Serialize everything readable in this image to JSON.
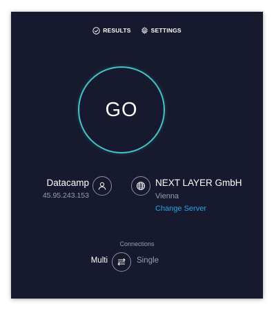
{
  "nav": {
    "results_label": "RESULTS",
    "settings_label": "SETTINGS"
  },
  "go_button": {
    "label": "GO"
  },
  "provider": {
    "name": "Datacamp",
    "ip": "45.95.243.153"
  },
  "server": {
    "name": "NEXT LAYER GmbH",
    "city": "Vienna",
    "change_label": "Change Server"
  },
  "connections": {
    "label": "Connections",
    "multi_label": "Multi",
    "single_label": "Single",
    "selected": "Multi"
  },
  "colors": {
    "background": "#171a2e",
    "accent_ring": "#3fc6c6",
    "link": "#1fa4e6",
    "muted_text": "#9a9eb0"
  },
  "icons": {
    "results": "check-circle-icon",
    "settings": "gear-icon",
    "provider": "user-icon",
    "server": "globe-icon",
    "connections": "arrows-exchange-icon"
  }
}
